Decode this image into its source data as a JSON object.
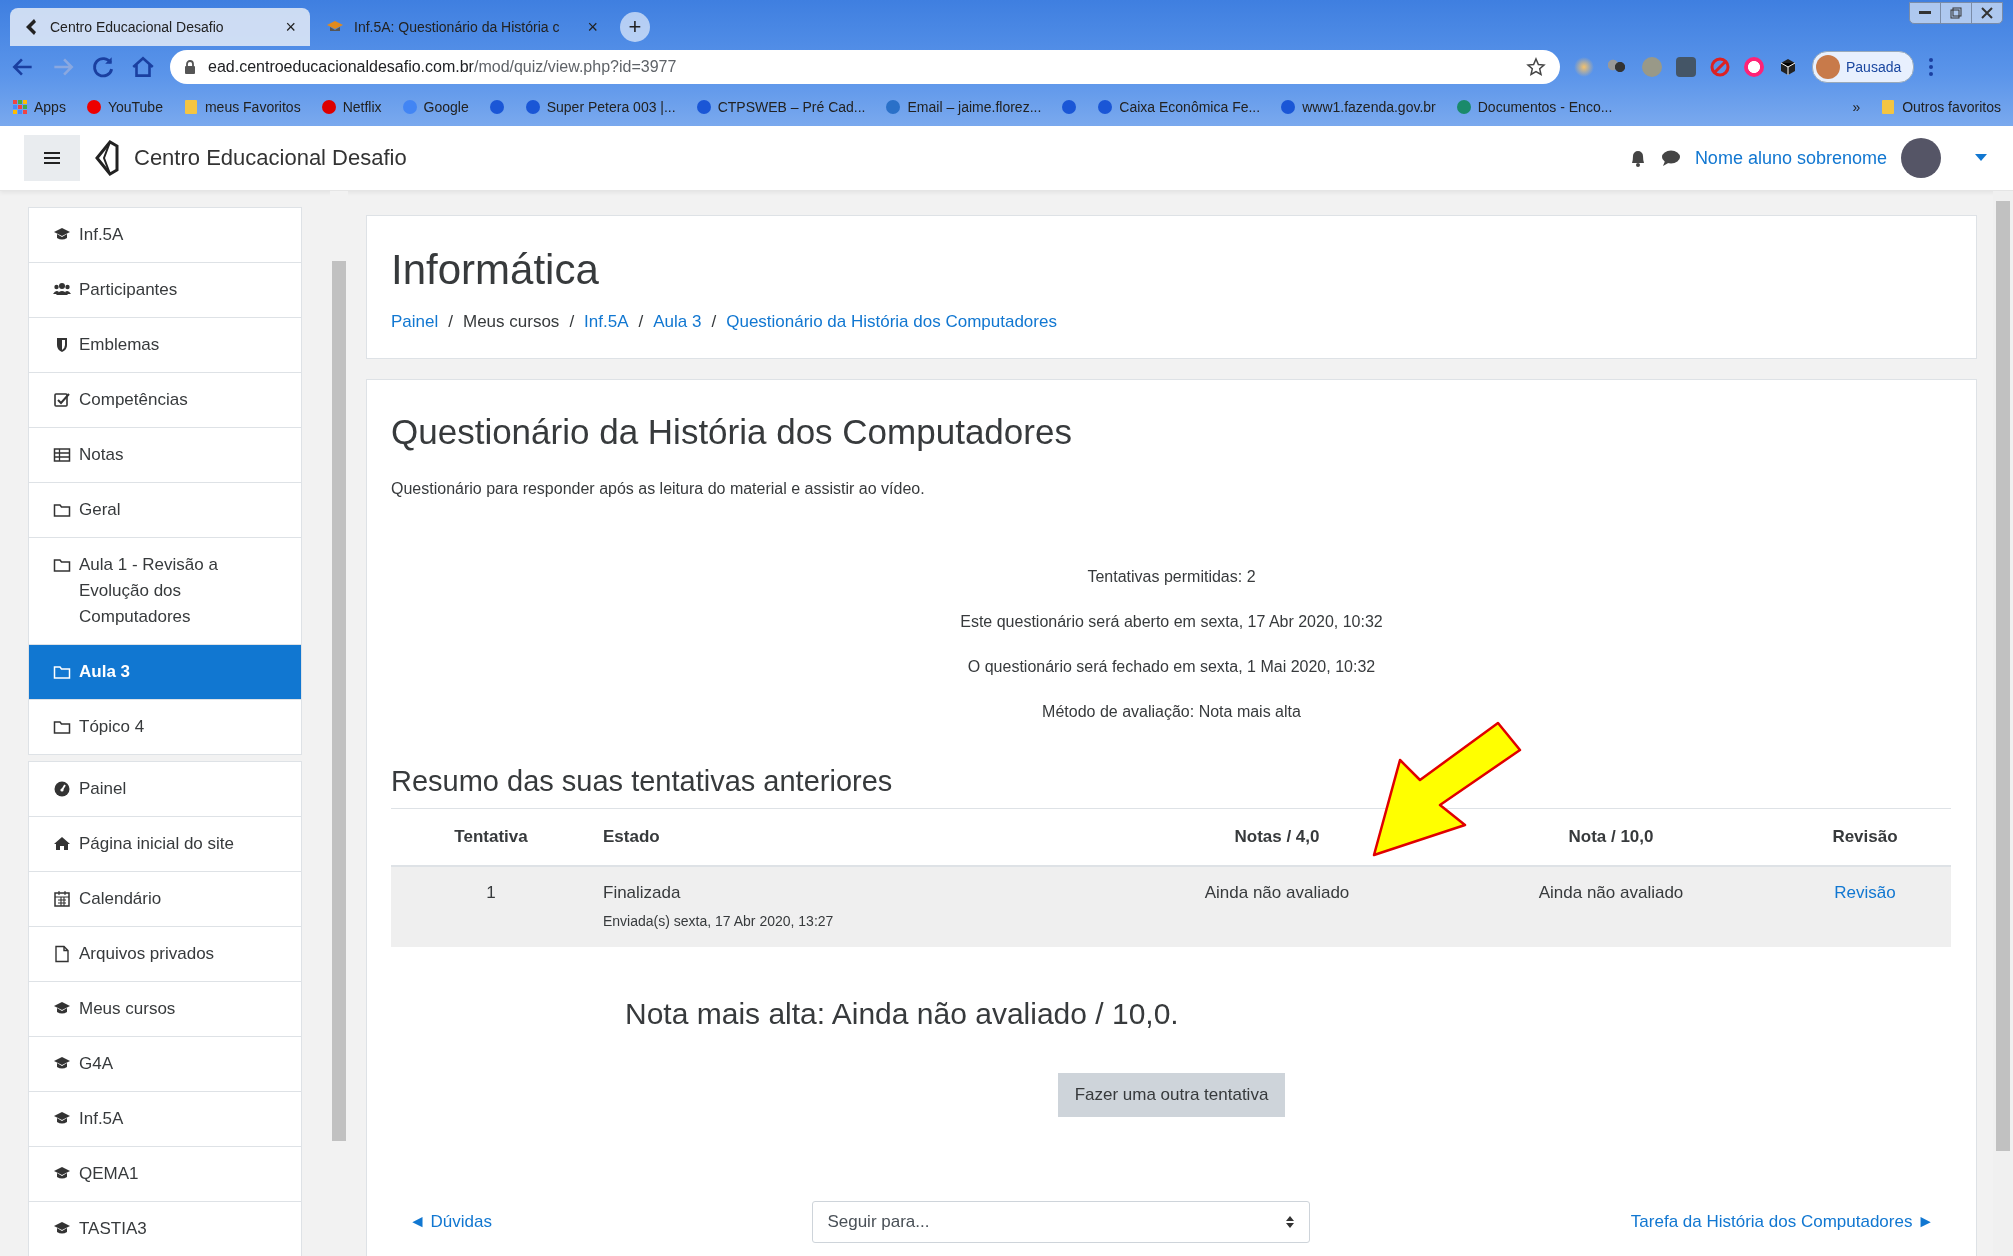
{
  "browser": {
    "tabs": [
      {
        "title": "Centro Educacional Desafio",
        "close": "×",
        "selected": true
      },
      {
        "title": "Inf.5A: Questionário da História c",
        "close": "×",
        "selected": false
      }
    ],
    "new_tab": "+",
    "address": {
      "host": "ead.centroeducacionaldesafio.com.br",
      "path": "/mod/quiz/view.php?id=3977"
    },
    "profile": "Pausada",
    "bookmarks": [
      {
        "kind": "labeled",
        "label": "Apps"
      },
      {
        "kind": "labeled",
        "label": "YouTube"
      },
      {
        "kind": "labeled",
        "label": "meus Favoritos"
      },
      {
        "kind": "labeled",
        "label": "Netflix"
      },
      {
        "kind": "labeled",
        "label": "Google"
      },
      {
        "kind": "icon"
      },
      {
        "kind": "labeled",
        "label": "Super Petera 003 |..."
      },
      {
        "kind": "labeled",
        "label": "CTPSWEB – Pré Cad..."
      },
      {
        "kind": "labeled",
        "label": "Email – jaime.florez..."
      },
      {
        "kind": "icon"
      },
      {
        "kind": "labeled",
        "label": "Caixa Econômica Fe..."
      },
      {
        "kind": "labeled",
        "label": "www1.fazenda.gov.br"
      },
      {
        "kind": "labeled",
        "label": "Documentos - Enco..."
      }
    ],
    "more_bookmarks": "»",
    "other_bookmarks": "Outros favoritos"
  },
  "header": {
    "site_name": "Centro Educacional Desafio",
    "user_name": "Nome aluno sobrenome"
  },
  "sidebar": {
    "groups": [
      [
        {
          "label": "Inf.5A",
          "selected": false
        },
        {
          "label": "Participantes",
          "selected": false
        },
        {
          "label": "Emblemas",
          "selected": false
        },
        {
          "label": "Competências",
          "selected": false
        },
        {
          "label": "Notas",
          "selected": false
        },
        {
          "label": "Geral",
          "selected": false
        },
        {
          "label": "Aula 1 - Revisão a Evolução dos Computadores",
          "selected": false
        },
        {
          "label": "Aula 3",
          "selected": true
        },
        {
          "label": "Tópico 4",
          "selected": false
        }
      ],
      [
        {
          "label": "Painel",
          "selected": false
        },
        {
          "label": "Página inicial do site",
          "selected": false
        },
        {
          "label": "Calendário",
          "selected": false
        },
        {
          "label": "Arquivos privados",
          "selected": false
        },
        {
          "label": "Meus cursos",
          "selected": false
        },
        {
          "label": "G4A",
          "selected": false
        },
        {
          "label": "Inf.5A",
          "selected": false
        },
        {
          "label": "QEMA1",
          "selected": false
        },
        {
          "label": "TASTIA3",
          "selected": false
        }
      ]
    ]
  },
  "page_header": {
    "title": "Informática",
    "breadcrumb": [
      {
        "label": "Painel",
        "link": true
      },
      {
        "label": "Meus cursos",
        "link": false
      },
      {
        "label": "Inf.5A",
        "link": true
      },
      {
        "label": "Aula 3",
        "link": true
      },
      {
        "label": "Questionário da História dos Computadores",
        "link": true
      }
    ],
    "separator": "/"
  },
  "quiz": {
    "title": "Questionário da História dos Computadores",
    "description": "Questionário para responder após as leitura do material e assistir ao vídeo.",
    "info": [
      "Tentativas permitidas: 2",
      "Este questionário será aberto em sexta, 17 Abr 2020, 10:32",
      "O questionário será fechado em sexta, 1 Mai 2020, 10:32",
      "Método de avaliação: Nota mais alta"
    ],
    "summary_title": "Resumo das suas tentativas anteriores",
    "table": {
      "columns": [
        "Tentativa",
        "Estado",
        "Notas / 4,0",
        "Nota / 10,0",
        "Revisão"
      ],
      "rows": [
        {
          "attempt": "1",
          "state": "Finalizada",
          "submitted": "Enviada(s) sexta, 17 Abr 2020, 13:27",
          "grade_4": "Ainda não avaliado",
          "grade_10": "Ainda não avaliado",
          "review": "Revisão"
        }
      ]
    },
    "highest_grade": "Nota mais alta: Ainda não avaliado / 10,0.",
    "retry_button": "Fazer uma outra tentativa"
  },
  "footer_nav": {
    "previous": "◄ Dúvidas",
    "jump_placeholder": "Seguir para...",
    "next": "Tarefa da História dos Computadores ►"
  }
}
